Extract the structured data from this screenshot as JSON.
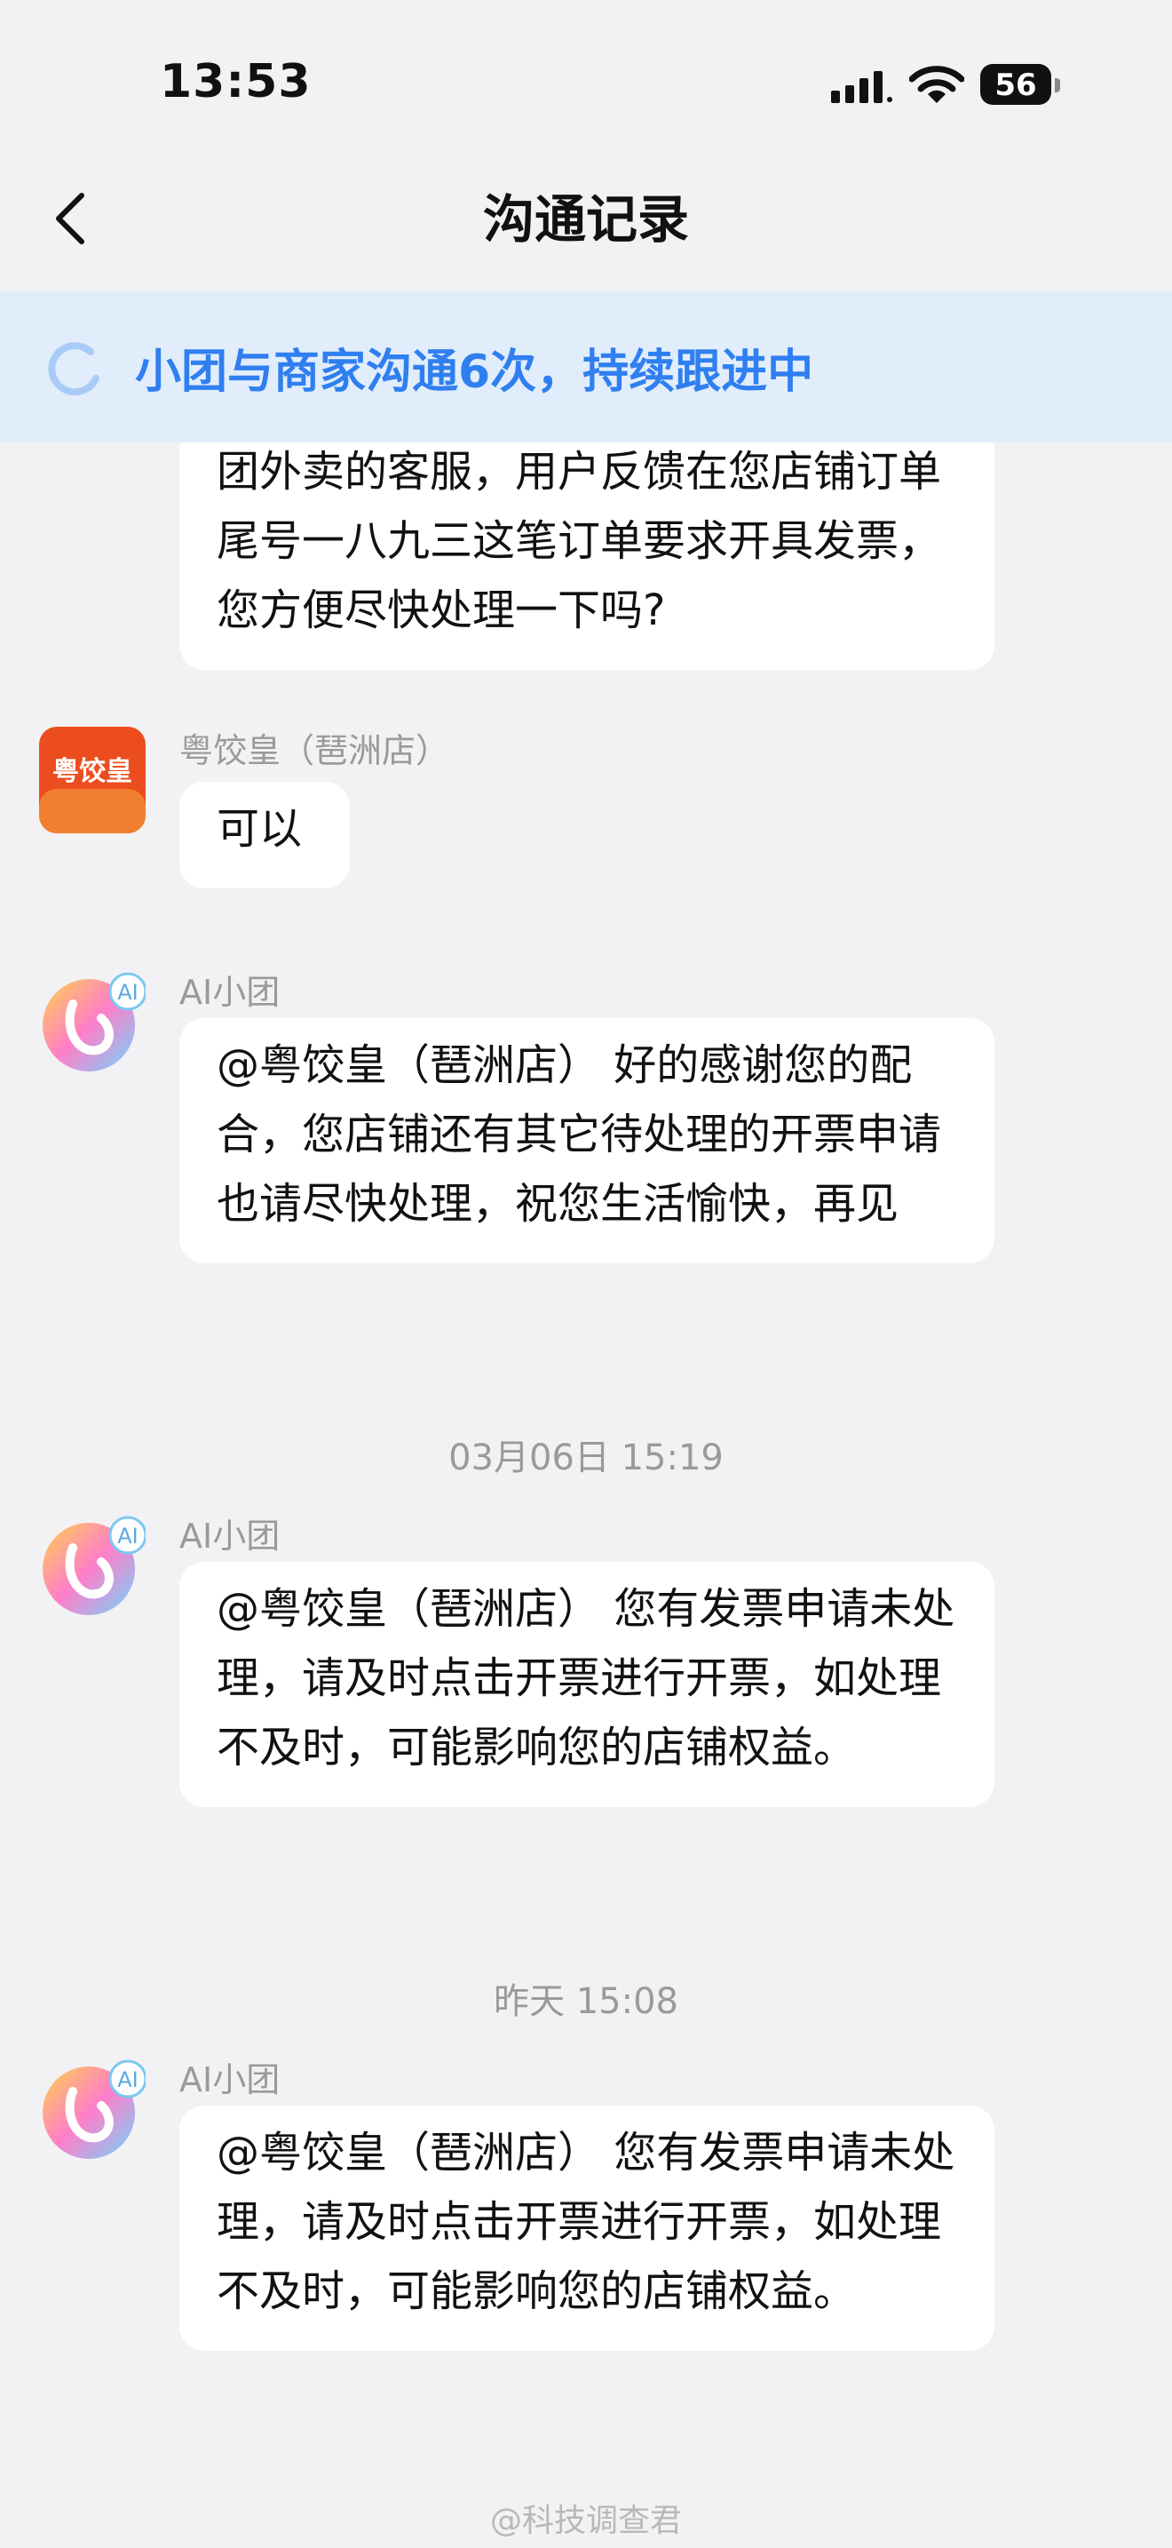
{
  "status_bar": {
    "time": "13:53",
    "battery": "56"
  },
  "nav": {
    "title": "沟通记录"
  },
  "banner": {
    "text": "小团与商家沟通6次，持续跟进中"
  },
  "messages": [
    {
      "text": "团外卖的客服，用户反馈在您店铺订单尾号一八九三这笔订单要求开具发票，您方便尽快处理一下吗?"
    },
    {
      "sender": "粤饺皇（琶洲店）",
      "avatar_text": "粤饺皇",
      "text": "可以"
    },
    {
      "sender": "AI小团",
      "text": "@粤饺皇（琶洲店） 好的感谢您的配合，您店铺还有其它待处理的开票申请也请尽快处理，祝您生活愉快，再见"
    },
    {
      "timestamp": "03月06日 15:19"
    },
    {
      "sender": "AI小团",
      "text": "@粤饺皇（琶洲店） 您有发票申请未处理，请及时点击开票进行开票，如处理不及时，可能影响您的店铺权益。"
    },
    {
      "timestamp": "昨天 15:08"
    },
    {
      "sender": "AI小团",
      "text": "@粤饺皇（琶洲店） 您有发票申请未处理，请及时点击开票进行开票，如处理不及时，可能影响您的店铺权益。"
    }
  ],
  "ai_avatar_label": "AI",
  "watermark": "@科技调查君"
}
